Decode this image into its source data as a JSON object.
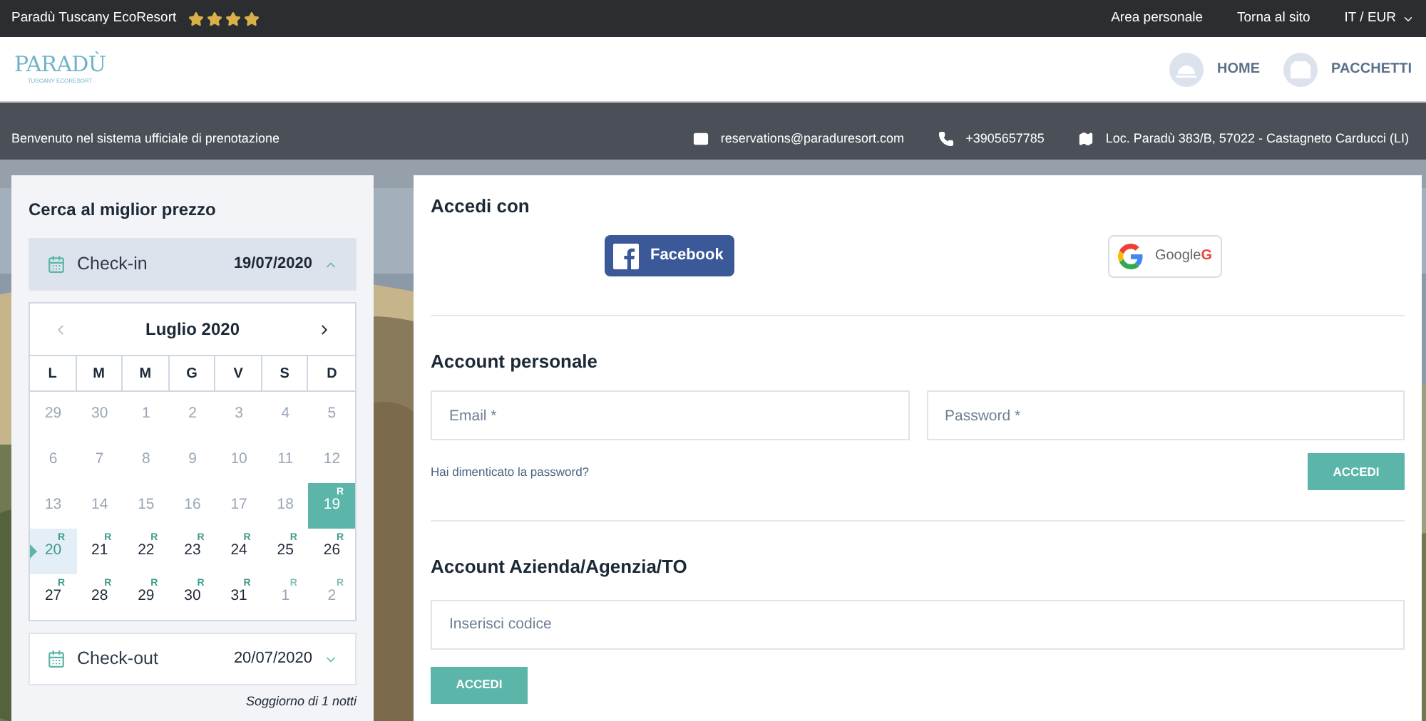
{
  "top_bar": {
    "title": "Paradù Tuscany EcoResort",
    "stars": 4,
    "links": [
      "Area personale",
      "Torna al sito"
    ],
    "locale": "IT / EUR"
  },
  "header": {
    "logo": {
      "wordmark": "PARADÙ",
      "tagline": "TUSCANY ECORESORT"
    },
    "nav": [
      {
        "label": "HOME"
      },
      {
        "label": "PACCHETTI"
      }
    ]
  },
  "info_bar": {
    "welcome": "Benvenuto nel sistema ufficiale di prenotazione",
    "contacts": [
      {
        "kind": "email",
        "text": "reservations@paraduresort.com"
      },
      {
        "kind": "phone",
        "text": "+3905657785"
      },
      {
        "kind": "map",
        "text": "Loc. Paradù 383/B, 57022 - Castagneto Carducci (LI)"
      }
    ]
  },
  "search": {
    "title": "Cerca al miglior prezzo",
    "checkin": {
      "label": "Check-in",
      "value": "19/07/2020",
      "expanded": true
    },
    "calendar": {
      "month": "Luglio 2020",
      "weekdays": [
        "L",
        "M",
        "M",
        "G",
        "V",
        "S",
        "D"
      ],
      "days": [
        {
          "day": "29",
          "muted": true,
          "selected": false
        },
        {
          "day": "30",
          "muted": true,
          "selected": false
        },
        {
          "day": "1",
          "muted": true,
          "selected": false
        },
        {
          "day": "2",
          "muted": true,
          "selected": false
        },
        {
          "day": "3",
          "muted": true,
          "selected": false
        },
        {
          "day": "4",
          "muted": true,
          "selected": false
        },
        {
          "day": "5",
          "muted": true,
          "selected": false
        },
        {
          "day": "6",
          "muted": true,
          "selected": false
        },
        {
          "day": "7",
          "muted": true,
          "selected": false
        },
        {
          "day": "8",
          "muted": true,
          "selected": false
        },
        {
          "day": "9",
          "muted": true,
          "selected": false
        },
        {
          "day": "10",
          "muted": true,
          "selected": false
        },
        {
          "day": "11",
          "muted": true,
          "selected": false
        },
        {
          "day": "12",
          "muted": true,
          "selected": false
        },
        {
          "day": "13",
          "muted": true,
          "selected": false
        },
        {
          "day": "14",
          "muted": true,
          "selected": false
        },
        {
          "day": "15",
          "muted": true,
          "selected": false
        },
        {
          "day": "16",
          "muted": true,
          "selected": false
        },
        {
          "day": "17",
          "muted": true,
          "selected": false
        },
        {
          "day": "18",
          "muted": true,
          "selected": false
        },
        {
          "day": "19",
          "muted": false,
          "selected": true,
          "badge": "R"
        },
        {
          "day": "20",
          "muted": false,
          "selected": false,
          "in_range": true,
          "badge": "R"
        },
        {
          "day": "21",
          "muted": false,
          "selected": false,
          "badge": "R"
        },
        {
          "day": "22",
          "muted": false,
          "selected": false,
          "badge": "R"
        },
        {
          "day": "23",
          "muted": false,
          "selected": false,
          "badge": "R"
        },
        {
          "day": "24",
          "muted": false,
          "selected": false,
          "badge": "R"
        },
        {
          "day": "25",
          "muted": false,
          "selected": false,
          "badge": "R"
        },
        {
          "day": "26",
          "muted": false,
          "selected": false,
          "badge": "R"
        },
        {
          "day": "27",
          "muted": false,
          "selected": false,
          "badge": "R"
        },
        {
          "day": "28",
          "muted": false,
          "selected": false,
          "badge": "R"
        },
        {
          "day": "29",
          "muted": false,
          "selected": false,
          "badge": "R"
        },
        {
          "day": "30",
          "muted": false,
          "selected": false,
          "badge": "R"
        },
        {
          "day": "31",
          "muted": false,
          "selected": false,
          "badge": "R"
        },
        {
          "day": "1",
          "muted": true,
          "selected": false,
          "badge": "R"
        },
        {
          "day": "2",
          "muted": true,
          "selected": false,
          "badge": "R"
        }
      ]
    },
    "checkout": {
      "label": "Check-out",
      "value": "20/07/2020",
      "expanded": false
    },
    "stay": "Soggiorno di 1 notti"
  },
  "login": {
    "social_title": "Accedi con",
    "social": [
      {
        "kind": "facebook",
        "label": "Facebook"
      },
      {
        "kind": "google",
        "label": "Google",
        "mark": "G"
      }
    ],
    "personal": {
      "title": "Account personale",
      "email_placeholder": "Email *",
      "password_placeholder": "Password *",
      "forgot": "Hai dimenticato la password?",
      "button": "ACCEDI"
    },
    "company": {
      "title": "Account Azienda/Agenzia/TO",
      "code_placeholder": "Inserisci codice",
      "button": "ACCEDI"
    }
  }
}
